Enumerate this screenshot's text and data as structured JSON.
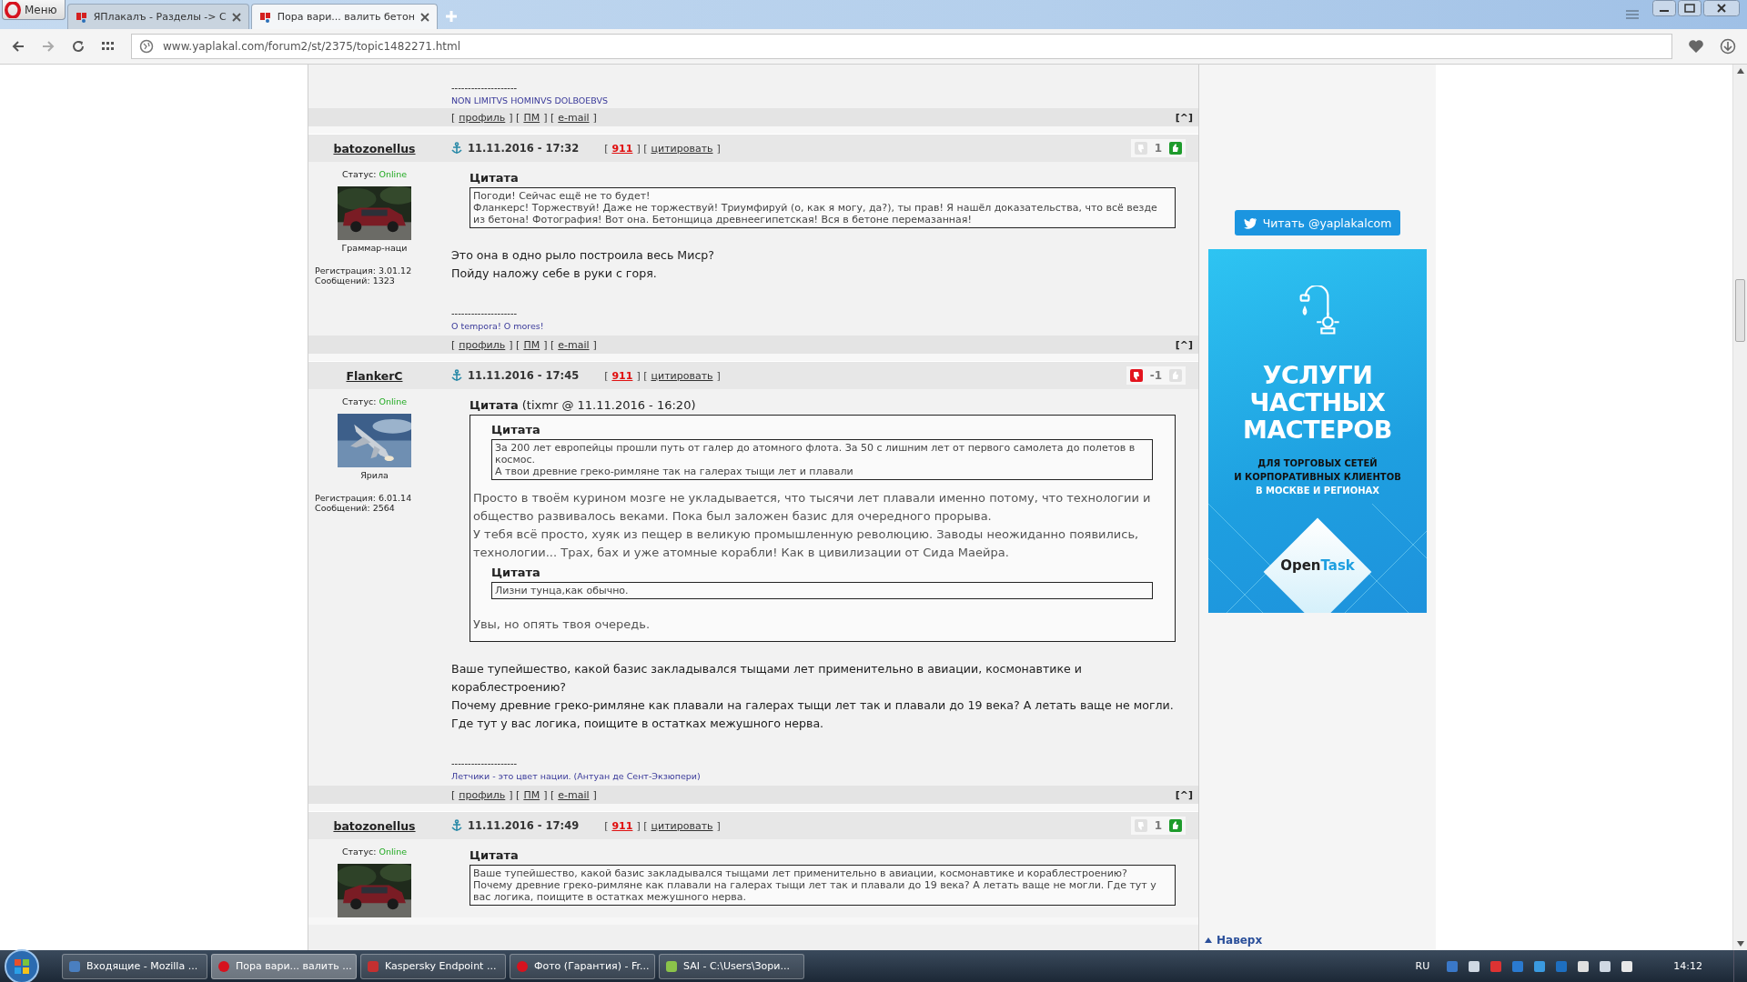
{
  "browser": {
    "menu_label": "Меню",
    "tabs": [
      {
        "title": "ЯПлакалъ - Разделы -> С",
        "selected": false
      },
      {
        "title": "Пора вари... валить бетон",
        "selected": true
      }
    ],
    "url": "www.yaplakal.com/forum2/st/2375/topic1482271.html"
  },
  "forum": {
    "partial_post": {
      "signature_rule": "--------------------",
      "signature": "NON LIMITVS HOMINVS DOLBOEBVS",
      "footer": [
        "[",
        "профиль",
        "] [",
        "ПМ",
        "] [",
        "e-mail",
        "]"
      ],
      "top_link": "[^]"
    },
    "posts": [
      {
        "author": "batozonellus",
        "date": "11.11.2016 - 17:32",
        "actions": [
          "[",
          "911",
          "] [",
          "цитировать",
          "]"
        ],
        "rating": {
          "count": "1",
          "down_voted": false,
          "up_voted": true
        },
        "user": {
          "status_label": "Статус:",
          "status": "Online",
          "online": true,
          "rank": "Граммар-наци",
          "registered": "Регистрация: 3.01.12",
          "messages": "Сообщений: 1323"
        },
        "body": [
          {
            "kind": "quote",
            "title": "Цитата",
            "body": [
              {
                "kind": "note",
                "lines": [
                  "Погоди! Сейчас ещё не то будет!",
                  "Фланкерс! Торжествуй! Даже не торжествуй! Триумфируй (о, как я могу, да?), ты прав! Я нашёл доказательства, что всё везде из бетона! Фотография! Вот она. Бетонщица древнеегипетская! Вся в бетоне перемазанная!"
                ]
              }
            ]
          },
          {
            "kind": "text",
            "lines": [
              "Это она в одно рыло построила весь Миср?",
              "Пойду наложу себе в руки с горя."
            ]
          }
        ],
        "signature_rule": "--------------------",
        "signature": "O tempora! O mores!",
        "footer": [
          "[",
          "профиль",
          "] [",
          "ПМ",
          "] [",
          "e-mail",
          "]"
        ],
        "top_link": "[^]"
      },
      {
        "author": "FlankerC",
        "date": "11.11.2016 - 17:45",
        "actions": [
          "[",
          "911",
          "] [",
          "цитировать",
          "]"
        ],
        "rating": {
          "count": "-1",
          "down_voted": true,
          "up_voted": false
        },
        "user": {
          "status_label": "Статус:",
          "status": "Online",
          "online": true,
          "rank": "Ярила",
          "registered": "Регистрация: 6.01.14",
          "messages": "Сообщений: 2564"
        },
        "body": [
          {
            "kind": "quote",
            "title": "Цитата",
            "source": "(tixmr @ 11.11.2016 - 16:20)",
            "body": [
              {
                "kind": "quote",
                "title": "Цитата",
                "body": [
                  {
                    "kind": "note",
                    "lines": [
                      "За 200 лет европейцы прошли путь от галер до атомного флота. За 50 с лишним лет от первого самолета до полетов в космос.",
                      "А твои древние греко-римляне так на галерах тыщи лет и плавали"
                    ]
                  }
                ]
              },
              {
                "kind": "text",
                "lines": [
                  "Просто в твоём курином мозге не укладывается, что тысячи лет плавали именно потому, что технологии и общество развивалось веками. Пока был заложен базис для очередного прорыва.",
                  "У тебя всё просто, хуяк из пещер в великую промышленную революцию. Заводы неожиданно появились, технологии... Трах, бах и уже атомные корабли! Как в цивилизации от Сида Маейра."
                ]
              },
              {
                "kind": "quote",
                "title": "Цитата",
                "body": [
                  {
                    "kind": "note",
                    "lines": [
                      "Лизни тунца,как обычно."
                    ]
                  }
                ]
              },
              {
                "kind": "text",
                "lines": [
                  "Увы, но опять твоя очередь."
                ]
              }
            ]
          },
          {
            "kind": "text",
            "lines": [
              "Ваше тупейшество, какой базис закладывался тыщами лет применительно в авиации, космонавтике и кораблестроению?",
              "Почему древние греко-римляне как плавали на галерах тыщи лет так и плавали до 19 века? А летать ваще не могли.",
              "Где тут у вас логика, поищите в остатках межушного нерва."
            ]
          }
        ],
        "signature_rule": "--------------------",
        "signature": "Летчики - это цвет нации. (Антуан де Сент-Экзюпери)",
        "footer": [
          "[",
          "профиль",
          "] [",
          "ПМ",
          "] [",
          "e-mail",
          "]"
        ],
        "top_link": "[^]"
      },
      {
        "author": "batozonellus",
        "date": "11.11.2016 - 17:49",
        "actions": [
          "[",
          "911",
          "] [",
          "цитировать",
          "]"
        ],
        "rating": {
          "count": "1",
          "down_voted": false,
          "up_voted": true
        },
        "user": {
          "status_label": "Статус:",
          "status": "Online",
          "online": true
        },
        "body": [
          {
            "kind": "quote",
            "title": "Цитата",
            "body": [
              {
                "kind": "note",
                "lines": [
                  "Ваше тупейшество, какой базис закладывался тыщами лет применительно в авиации, космонавтике и кораблестроению?",
                  "Почему древние греко-римляне как плавали на галерах тыщи лет так и плавали до 19 века? А летать ваще не могли. Где тут у вас логика, поищите в остатках межушного нерва."
                ]
              }
            ]
          }
        ]
      }
    ]
  },
  "sidebar": {
    "twitter_button": "Читать @yaplakalcom",
    "ad": {
      "heading": [
        "УСЛУГИ",
        "ЧАСТНЫХ",
        "МАСТЕРОВ"
      ],
      "subheading": [
        {
          "text": "ДЛЯ ТОРГОВЫХ СЕТЕЙ",
          "kind": "plain"
        },
        {
          "text": "И КОРПОРАТИВНЫХ КЛИЕНТОВ",
          "kind": "plain"
        },
        {
          "text": "В МОСКВЕ И РЕГИОНАХ",
          "kind": "accent"
        }
      ],
      "brand": [
        "Open",
        "Task"
      ]
    },
    "to_top_link": "Наверх"
  },
  "taskbar": {
    "tasks": [
      {
        "label": "Входящие - Mozilla ...",
        "selected": false
      },
      {
        "label": "Пора вари... валить ...",
        "selected": true
      },
      {
        "label": "Kaspersky Endpoint ...",
        "selected": false
      },
      {
        "label": "Фото (Гарантия) - Fr...",
        "selected": false
      },
      {
        "label": "SAI - C:\\Users\\Зори...",
        "selected": false
      }
    ],
    "language": "RU",
    "clock": "14:12"
  }
}
